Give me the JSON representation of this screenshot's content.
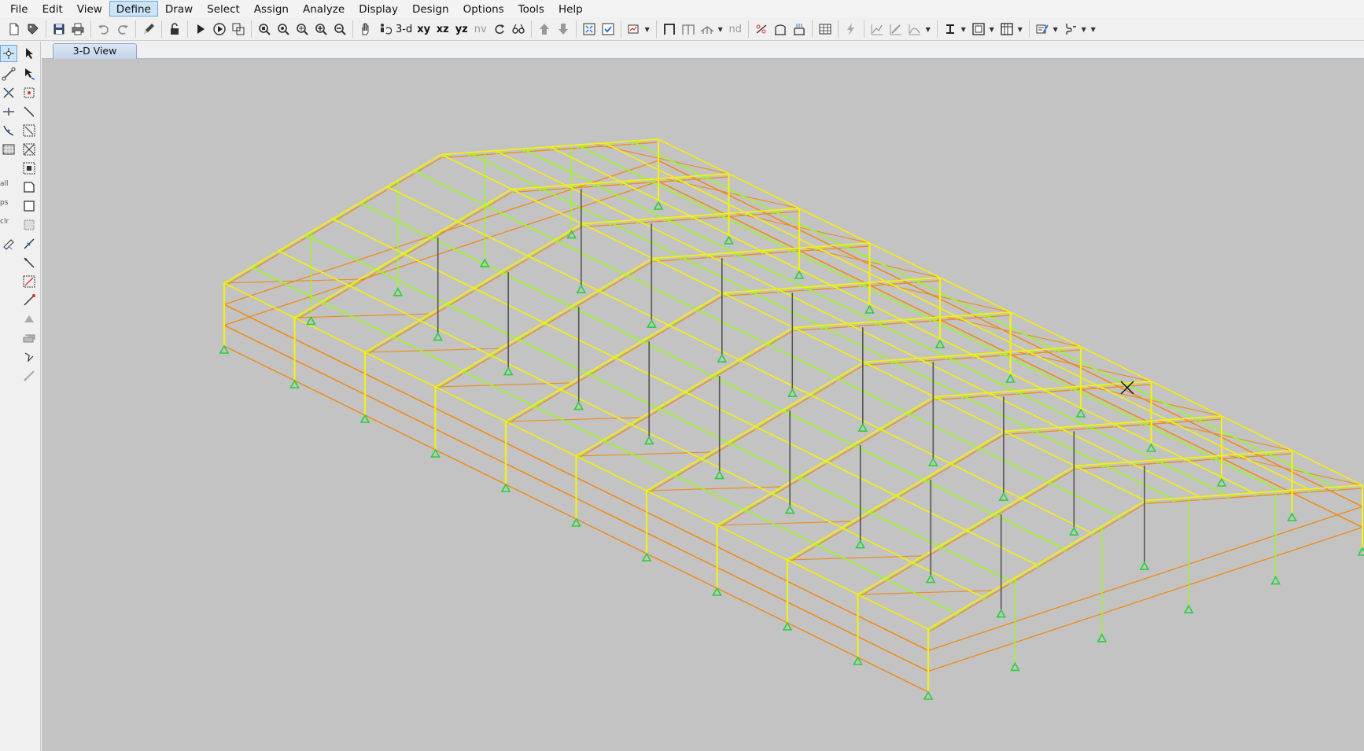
{
  "menu": {
    "items": [
      {
        "label": "File",
        "active": false
      },
      {
        "label": "Edit",
        "active": false
      },
      {
        "label": "View",
        "active": false
      },
      {
        "label": "Define",
        "active": true
      },
      {
        "label": "Draw",
        "active": false
      },
      {
        "label": "Select",
        "active": false
      },
      {
        "label": "Assign",
        "active": false
      },
      {
        "label": "Analyze",
        "active": false
      },
      {
        "label": "Display",
        "active": false
      },
      {
        "label": "Design",
        "active": false
      },
      {
        "label": "Options",
        "active": false
      },
      {
        "label": "Tools",
        "active": false
      },
      {
        "label": "Help",
        "active": false
      }
    ]
  },
  "toolbar": {
    "view_3d": "3-d",
    "view_xy": "xy",
    "view_xz": "xz",
    "view_yz": "yz",
    "view_nv": "nv",
    "label_nd": "nd"
  },
  "left_toolbar": {
    "label_all": "all",
    "label_ps": "ps",
    "label_clr": "clr"
  },
  "tabs": [
    {
      "label": "3-D View",
      "active": true
    }
  ],
  "model_colors": {
    "frame_yellow": "#f2ef1a",
    "frame_green": "#9ef52a",
    "frame_orange": "#f08a17",
    "column_dark": "#555555",
    "support_green": "#27d13a",
    "background": "#c3c3c3"
  }
}
